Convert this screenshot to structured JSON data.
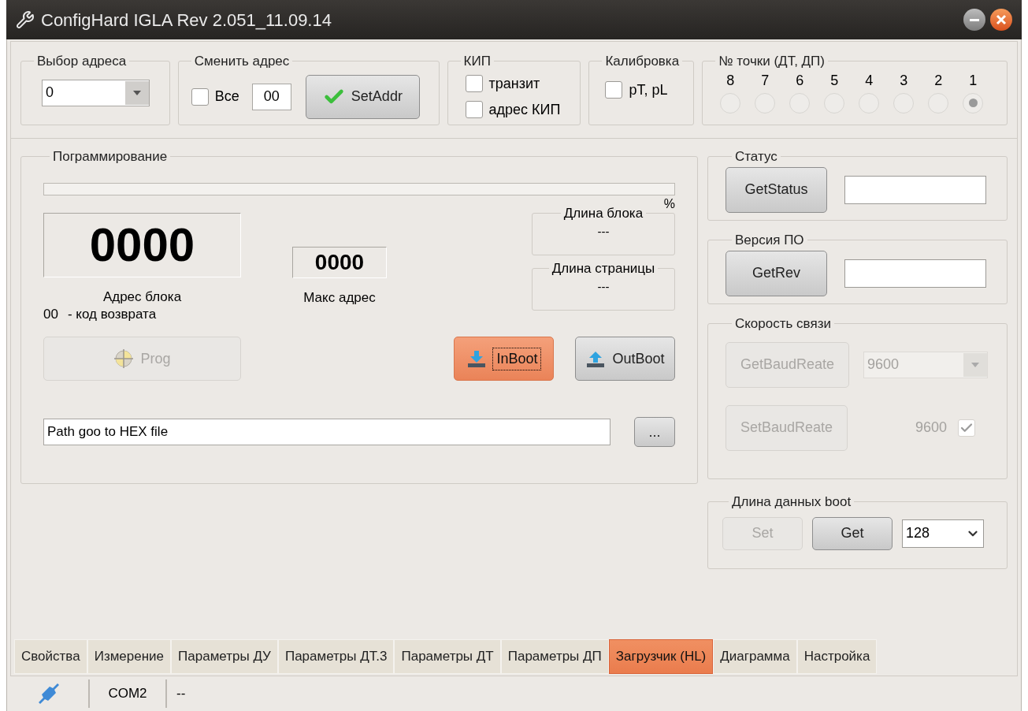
{
  "window": {
    "title": "ConfigHard IGLA Rev 2.051_11.09.14"
  },
  "address_select": {
    "label": "Выбор адреса",
    "value": "0"
  },
  "change_address": {
    "label": "Сменить адрес",
    "all": {
      "label": "Все",
      "checked": false
    },
    "value": "00",
    "button": "SetAddr"
  },
  "kip": {
    "label": "КИП",
    "options": [
      {
        "label": "транзит",
        "checked": false
      },
      {
        "label": "адрес КИП",
        "checked": false
      }
    ]
  },
  "calibration": {
    "label": "Калибровка",
    "option": {
      "label": "pT, pL",
      "checked": false
    }
  },
  "points": {
    "label": "№ точки (ДТ, ДП)",
    "items": [
      {
        "label": "8",
        "selected": false
      },
      {
        "label": "7",
        "selected": false
      },
      {
        "label": "6",
        "selected": false
      },
      {
        "label": "5",
        "selected": false
      },
      {
        "label": "4",
        "selected": false
      },
      {
        "label": "3",
        "selected": false
      },
      {
        "label": "2",
        "selected": false
      },
      {
        "label": "1",
        "selected": true
      }
    ]
  },
  "programming": {
    "label": "Пограммирование",
    "percent": "%",
    "block_address": {
      "value": "0000",
      "label": "Адрес блока"
    },
    "max_address": {
      "value": "0000",
      "label": "Макс адрес"
    },
    "block_length": {
      "label": "Длина блока",
      "value": "---"
    },
    "page_length": {
      "label": "Длина страницы",
      "value": "---"
    },
    "return_code": {
      "value": "00",
      "label": "- код возврата"
    },
    "buttons": [
      {
        "kind": "prog",
        "label": "Prog",
        "disabled": true,
        "focused": false
      },
      {
        "kind": "in",
        "label": "InBoot",
        "disabled": false,
        "focused": true
      },
      {
        "kind": "out",
        "label": "OutBoot",
        "disabled": false,
        "focused": false
      }
    ],
    "path": {
      "value": "Path goo to HEX file"
    },
    "browse": "..."
  },
  "status": {
    "label": "Статус",
    "button": "GetStatus"
  },
  "version": {
    "label": "Версия ПО",
    "button": "GetRev"
  },
  "baud": {
    "label": "Скорость связи",
    "get_button": {
      "label": "GetBaudReate",
      "disabled": true
    },
    "select": {
      "value": "9600",
      "disabled": true
    },
    "set_button": {
      "label": "SetBaudReate",
      "disabled": true
    },
    "check": {
      "label": "9600",
      "checked": true,
      "disabled": true
    }
  },
  "boot_length": {
    "label": "Длина данных boot",
    "buttons": [
      {
        "label": "Set",
        "disabled": true
      },
      {
        "label": "Get",
        "disabled": false
      }
    ],
    "select": {
      "value": "128"
    }
  },
  "tabs": [
    {
      "label": "Свойства",
      "selected": false
    },
    {
      "label": "Измерение",
      "selected": false
    },
    {
      "label": "Параметры ДУ",
      "selected": false
    },
    {
      "label": "Параметры ДТ.3",
      "selected": false
    },
    {
      "label": "Параметры ДТ",
      "selected": false
    },
    {
      "label": "Параметры ДП",
      "selected": false
    },
    {
      "label": "Загрузчик (HL)",
      "selected": true
    },
    {
      "label": "Диаграмма",
      "selected": false
    },
    {
      "label": "Настройка",
      "selected": false
    }
  ],
  "status_bar": {
    "port": "COM2",
    "message": "--"
  }
}
